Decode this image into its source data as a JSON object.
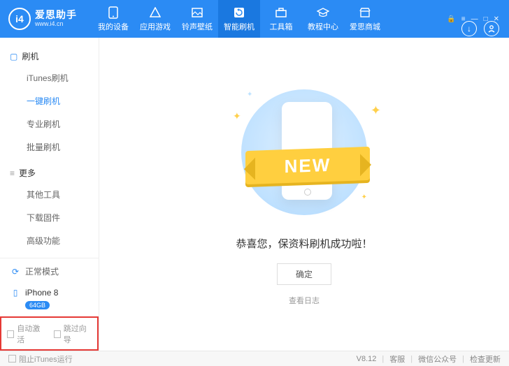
{
  "app": {
    "name": "爱思助手",
    "url": "www.i4.cn",
    "logo_text": "i4"
  },
  "nav": {
    "items": [
      {
        "label": "我的设备"
      },
      {
        "label": "应用游戏"
      },
      {
        "label": "铃声壁纸"
      },
      {
        "label": "智能刷机"
      },
      {
        "label": "工具箱"
      },
      {
        "label": "教程中心"
      },
      {
        "label": "爱思商城"
      }
    ],
    "active_index": 3
  },
  "sidebar": {
    "groups": [
      {
        "title": "刷机",
        "items": [
          "iTunes刷机",
          "一键刷机",
          "专业刷机",
          "批量刷机"
        ],
        "active_index": 1
      },
      {
        "title": "更多",
        "items": [
          "其他工具",
          "下载固件",
          "高级功能"
        ],
        "active_index": -1
      }
    ],
    "mode": "正常模式",
    "device": {
      "name": "iPhone 8",
      "storage": "64GB"
    },
    "checks": {
      "auto_activate": "自动激活",
      "skip_wizard": "跳过向导"
    }
  },
  "main": {
    "ribbon": "NEW",
    "message": "恭喜您，保资料刷机成功啦！",
    "ok": "确定",
    "view_log": "查看日志"
  },
  "footer": {
    "prevent_itunes": "阻止iTunes运行",
    "version": "V8.12",
    "links": [
      "客服",
      "微信公众号",
      "检查更新"
    ]
  }
}
